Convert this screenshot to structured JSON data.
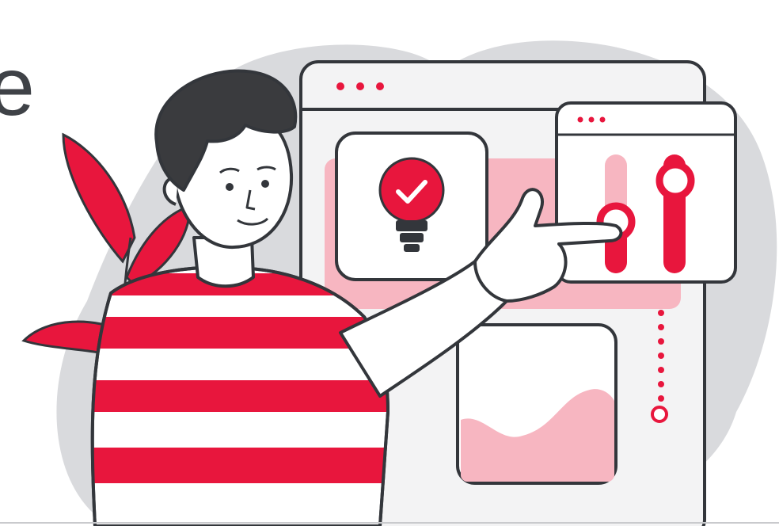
{
  "heading": {
    "visible_text": "e"
  },
  "colors": {
    "accent": "#e8163d",
    "accent_light": "#f7b6c1",
    "blob": "#d9dadd",
    "outline": "#33363b",
    "hair": "#3a3b3e",
    "panel": "#f3f3f4"
  },
  "illustration": {
    "icons": [
      "lightbulb-check-icon",
      "slider-controls-icon",
      "window-dots-icon"
    ]
  }
}
